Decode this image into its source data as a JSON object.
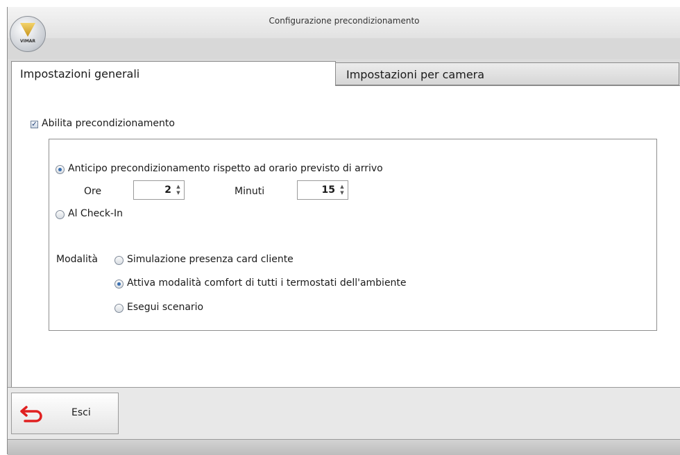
{
  "window": {
    "title": "Configurazione precondizionamento"
  },
  "logo": {
    "text": "VIMAR"
  },
  "tabs": [
    {
      "label": "Impostazioni generali",
      "active": true
    },
    {
      "label": "Impostazioni per camera",
      "active": false
    }
  ],
  "general": {
    "enable_label": "Abilita precondizionamento",
    "enable_checked": true,
    "advance_option": {
      "label": "Anticipo precondizionamento rispetto ad orario previsto di arrivo",
      "selected": true
    },
    "hours": {
      "label": "Ore",
      "value": "2"
    },
    "minutes": {
      "label": "Minuti",
      "value": "15"
    },
    "checkin_option": {
      "label": "Al Check-In",
      "selected": false
    },
    "mode_label": "Modalità",
    "modes": [
      {
        "label": "Simulazione presenza card cliente",
        "selected": false
      },
      {
        "label": "Attiva modalità comfort di tutti i termostati dell'ambiente",
        "selected": true
      },
      {
        "label": "Esegui scenario",
        "selected": false
      }
    ]
  },
  "footer": {
    "exit_label": "Esci"
  },
  "colors": {
    "exit_icon": "#e02020",
    "radio_dot": "#3a6fb0"
  }
}
